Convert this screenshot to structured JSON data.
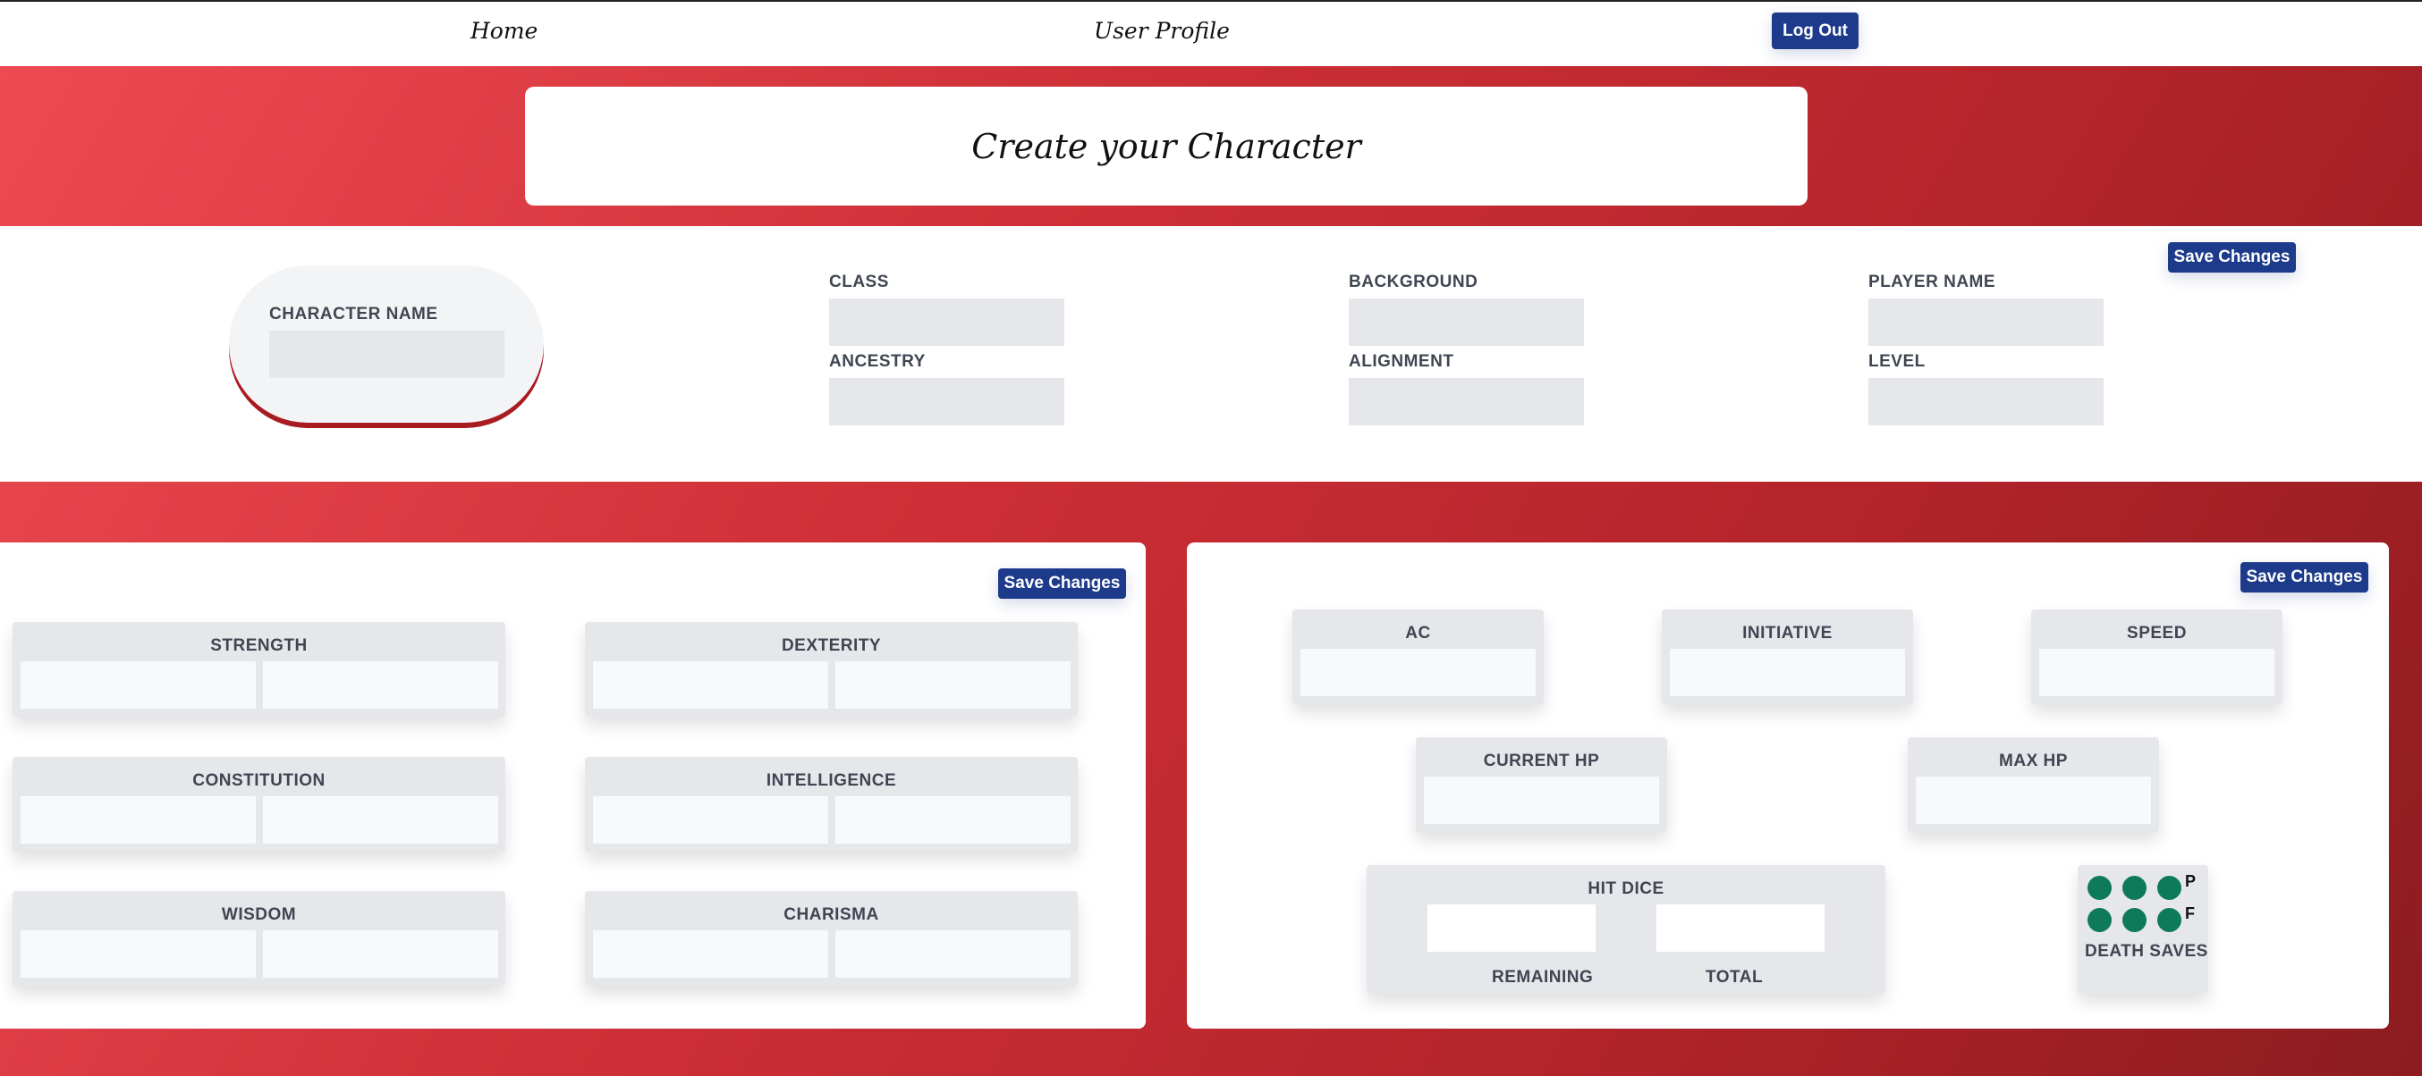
{
  "nav": {
    "home": "Home",
    "profile": "User Profile",
    "logout": "Log Out"
  },
  "title": "Create your Character",
  "info": {
    "save_label": "Save Changes",
    "character_name": "CHARACTER NAME",
    "class": "CLASS",
    "ancestry": "ANCESTRY",
    "background": "BACKGROUND",
    "alignment": "ALIGNMENT",
    "player_name": "PLAYER NAME",
    "level": "LEVEL"
  },
  "abilities": {
    "save_label": "Save Changes",
    "items": [
      "STRENGTH",
      "DEXTERITY",
      "CONSTITUTION",
      "INTELLIGENCE",
      "WISDOM",
      "CHARISMA"
    ]
  },
  "combat": {
    "save_label": "Save Changes",
    "ac": "AC",
    "initiative": "INITIATIVE",
    "speed": "SPEED",
    "current_hp": "CURRENT HP",
    "max_hp": "MAX HP",
    "hit_dice": "HIT DICE",
    "remaining": "REMAINING",
    "total": "TOTAL",
    "pass_marker": "P",
    "fail_marker": "F",
    "death_saves": "DEATH SAVES"
  },
  "colors": {
    "accent": "#1e3a8a",
    "death_save_dot": "#0f7a5a",
    "background_red": "#cd2f36"
  }
}
